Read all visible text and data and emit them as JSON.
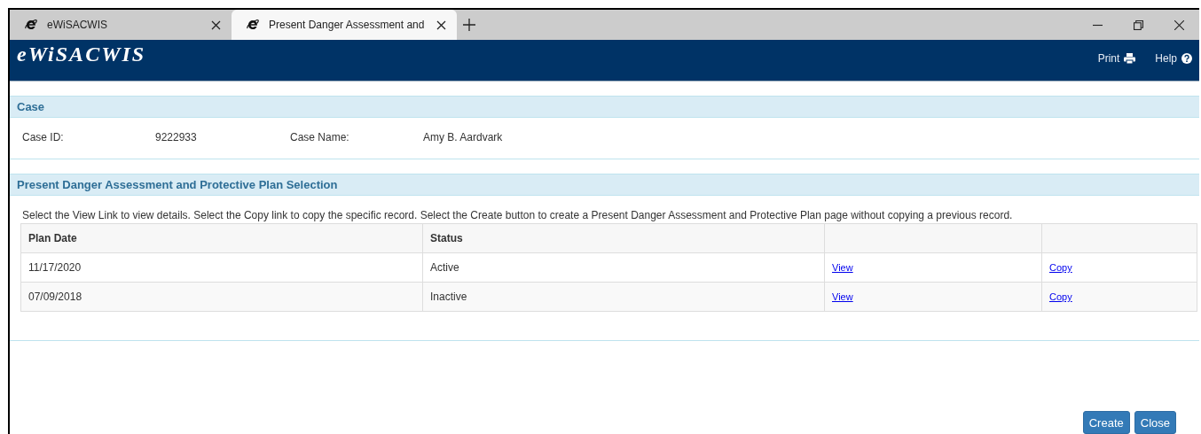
{
  "browser": {
    "tabs": [
      {
        "title": "eWiSACWIS",
        "selected": false
      },
      {
        "title": "Present Danger Assessment and",
        "selected": true
      }
    ]
  },
  "header": {
    "logo": "eWiSACWIS",
    "links": [
      {
        "label": "Print",
        "kind": "print"
      },
      {
        "label": "Help",
        "kind": "help"
      }
    ]
  },
  "case": {
    "title": "Case",
    "fields": [
      {
        "label": "Case ID:",
        "value": "9222933"
      },
      {
        "label": "Case Name:",
        "value": "Amy B. Aardvark"
      }
    ]
  },
  "selection": {
    "title": "Present Danger Assessment and Protective Plan Selection",
    "instructions": "Select the View Link to view details. Select the Copy link to copy the specific record.  Select the Create button to create a Present Danger Assessment and Protective Plan page without copying a previous record.",
    "columns": [
      "Plan Date",
      "Status"
    ],
    "rows": [
      {
        "plan_date": "11/17/2020",
        "status": "Active",
        "view": "View",
        "copy": "Copy"
      },
      {
        "plan_date": "07/09/2018",
        "status": "Inactive",
        "view": "View",
        "copy": "Copy"
      }
    ]
  },
  "buttons": [
    "Create",
    "Close"
  ]
}
